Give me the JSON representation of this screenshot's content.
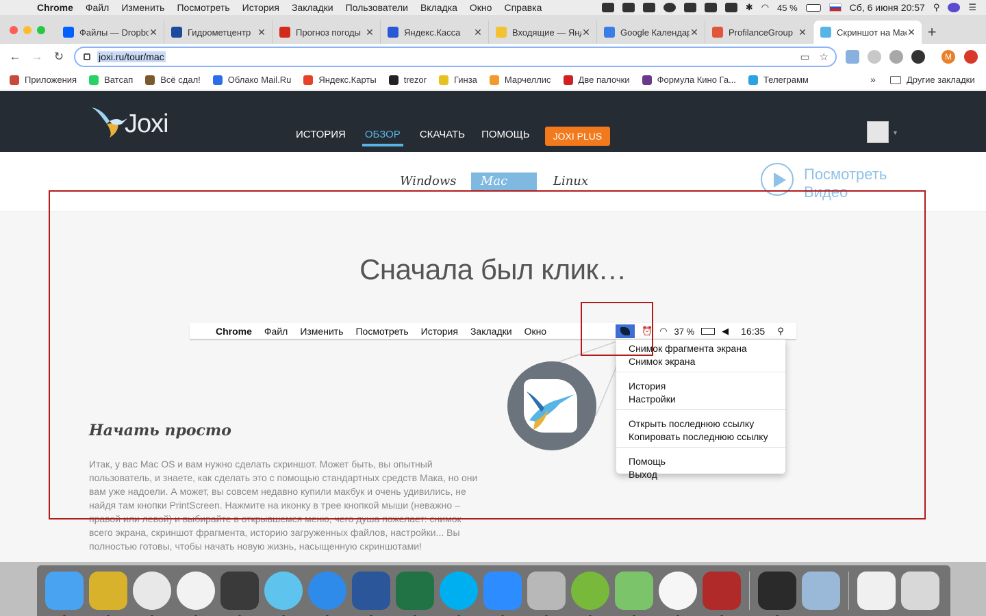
{
  "menubar": {
    "app": "Chrome",
    "items": [
      "Файл",
      "Изменить",
      "Посмотреть",
      "История",
      "Закладки",
      "Пользователи",
      "Вкладка",
      "Окно",
      "Справка"
    ],
    "battery": "45 %",
    "datetime": "Сб, 6 июня  20:57"
  },
  "tabs": [
    {
      "label": "Файлы — Dropbox",
      "color": "#0061fe"
    },
    {
      "label": "Гидрометцентр",
      "color": "#1d4a9a"
    },
    {
      "label": "Прогноз погоды",
      "color": "#d42a1c"
    },
    {
      "label": "Яндекс.Касса",
      "color": "#2a57d6"
    },
    {
      "label": "Входящие — Яндекс",
      "color": "#f2c230"
    },
    {
      "label": "Google Календарь",
      "color": "#3b7ce6"
    },
    {
      "label": "ProfilanceGroup",
      "color": "#e0553b"
    },
    {
      "label": "Скриншот на Mac",
      "color": "#57b4e5",
      "active": true
    }
  ],
  "toolbar": {
    "url": "joxi.ru/tour/mac",
    "profile_letter": "M"
  },
  "bookmarks": [
    {
      "label": "Приложения",
      "color": "#c84a3a"
    },
    {
      "label": "Ватсап",
      "color": "#25d366"
    },
    {
      "label": "Всё сдал!",
      "color": "#7a5a2a"
    },
    {
      "label": "Облако Mail.Ru",
      "color": "#2b6ee8"
    },
    {
      "label": "Яндекс.Карты",
      "color": "#e8412b"
    },
    {
      "label": "trezor",
      "color": "#222222"
    },
    {
      "label": "Гинза",
      "color": "#e8c020"
    },
    {
      "label": "Марчеллис",
      "color": "#f29a2e"
    },
    {
      "label": "Две палочки",
      "color": "#d02020"
    },
    {
      "label": "Формула Кино Га...",
      "color": "#6a3a8a"
    },
    {
      "label": "Телеграмм",
      "color": "#2aa3e0"
    }
  ],
  "bookmarks_more": "»",
  "bookmarks_other": "Другие закладки",
  "site": {
    "logo": "Joxi",
    "nav": [
      "ИСТОРИЯ",
      "ОБЗОР",
      "СКАЧАТЬ",
      "ПОМОЩЬ"
    ],
    "nav_active": "ОБЗОР",
    "plus": "JOXI PLUS",
    "os_tabs": [
      "Windows",
      "Mac OS",
      "Linux"
    ],
    "os_active": "Mac OS",
    "video_line1": "Посмотреть",
    "video_line2": "Видео",
    "headline": "Сначала был клик…",
    "mini_menubar": {
      "app": "Chrome",
      "items": [
        "Файл",
        "Изменить",
        "Посмотреть",
        "История",
        "Закладки",
        "Окно"
      ],
      "battery": "37 %",
      "time": "16:35"
    },
    "menu_groups": [
      [
        "Снимок фрагмента экрана",
        "Снимок экрана"
      ],
      [
        "История",
        "Настройки"
      ],
      [
        "Открыть последнюю ссылку",
        "Копировать последнюю ссылку"
      ],
      [
        "Помощь",
        "Выход"
      ]
    ],
    "subtitle": "Начать просто",
    "paragraph": "Итак, у вас Mac OS и вам нужно сделать скриншот. Может быть, вы опытный пользователь, и знаете, как сделать это с помощью стандартных средств Мака, но они вам уже надоели. А может, вы совсем недавно купили макбук и очень удивились, не найдя там кнопки PrintScreen. Нажмите на иконку в трее кнопкой мыши (неважно – правой или левой) и выбирайте в открывшемся меню, чего душа пожелает: снимок всего экрана, скриншот фрагмента, историю загруженных файлов, настройки... Вы полностью готовы, чтобы начать новую жизнь, насыщенную скриншотами!"
  },
  "dock": [
    {
      "name": "finder",
      "color": "#4aa3f0"
    },
    {
      "name": "forklift",
      "color": "#d8b22a"
    },
    {
      "name": "chrome",
      "color": "#e8e8e8"
    },
    {
      "name": "yandex-browser",
      "color": "#f2f2f2"
    },
    {
      "name": "sublime",
      "color": "#3a3a3a"
    },
    {
      "name": "screens",
      "color": "#5ec4ee"
    },
    {
      "name": "safari",
      "color": "#2f8bea"
    },
    {
      "name": "word",
      "color": "#2b579a"
    },
    {
      "name": "excel",
      "color": "#217346"
    },
    {
      "name": "skype",
      "color": "#00aff0"
    },
    {
      "name": "zoom",
      "color": "#2d8cff"
    },
    {
      "name": "calculator",
      "color": "#b8b8b8"
    },
    {
      "name": "utorrent",
      "color": "#78b83a"
    },
    {
      "name": "maps",
      "color": "#7cc46a"
    },
    {
      "name": "photos",
      "color": "#f6f6f6"
    },
    {
      "name": "photo-booth",
      "color": "#b02a2a"
    },
    {
      "name": "activity-monitor",
      "color": "#2a2a2a"
    },
    {
      "name": "preview",
      "color": "#9ab8d8"
    },
    {
      "name": "documents",
      "color": "#f0f0f0"
    },
    {
      "name": "trash",
      "color": "#d8d8d8"
    }
  ]
}
